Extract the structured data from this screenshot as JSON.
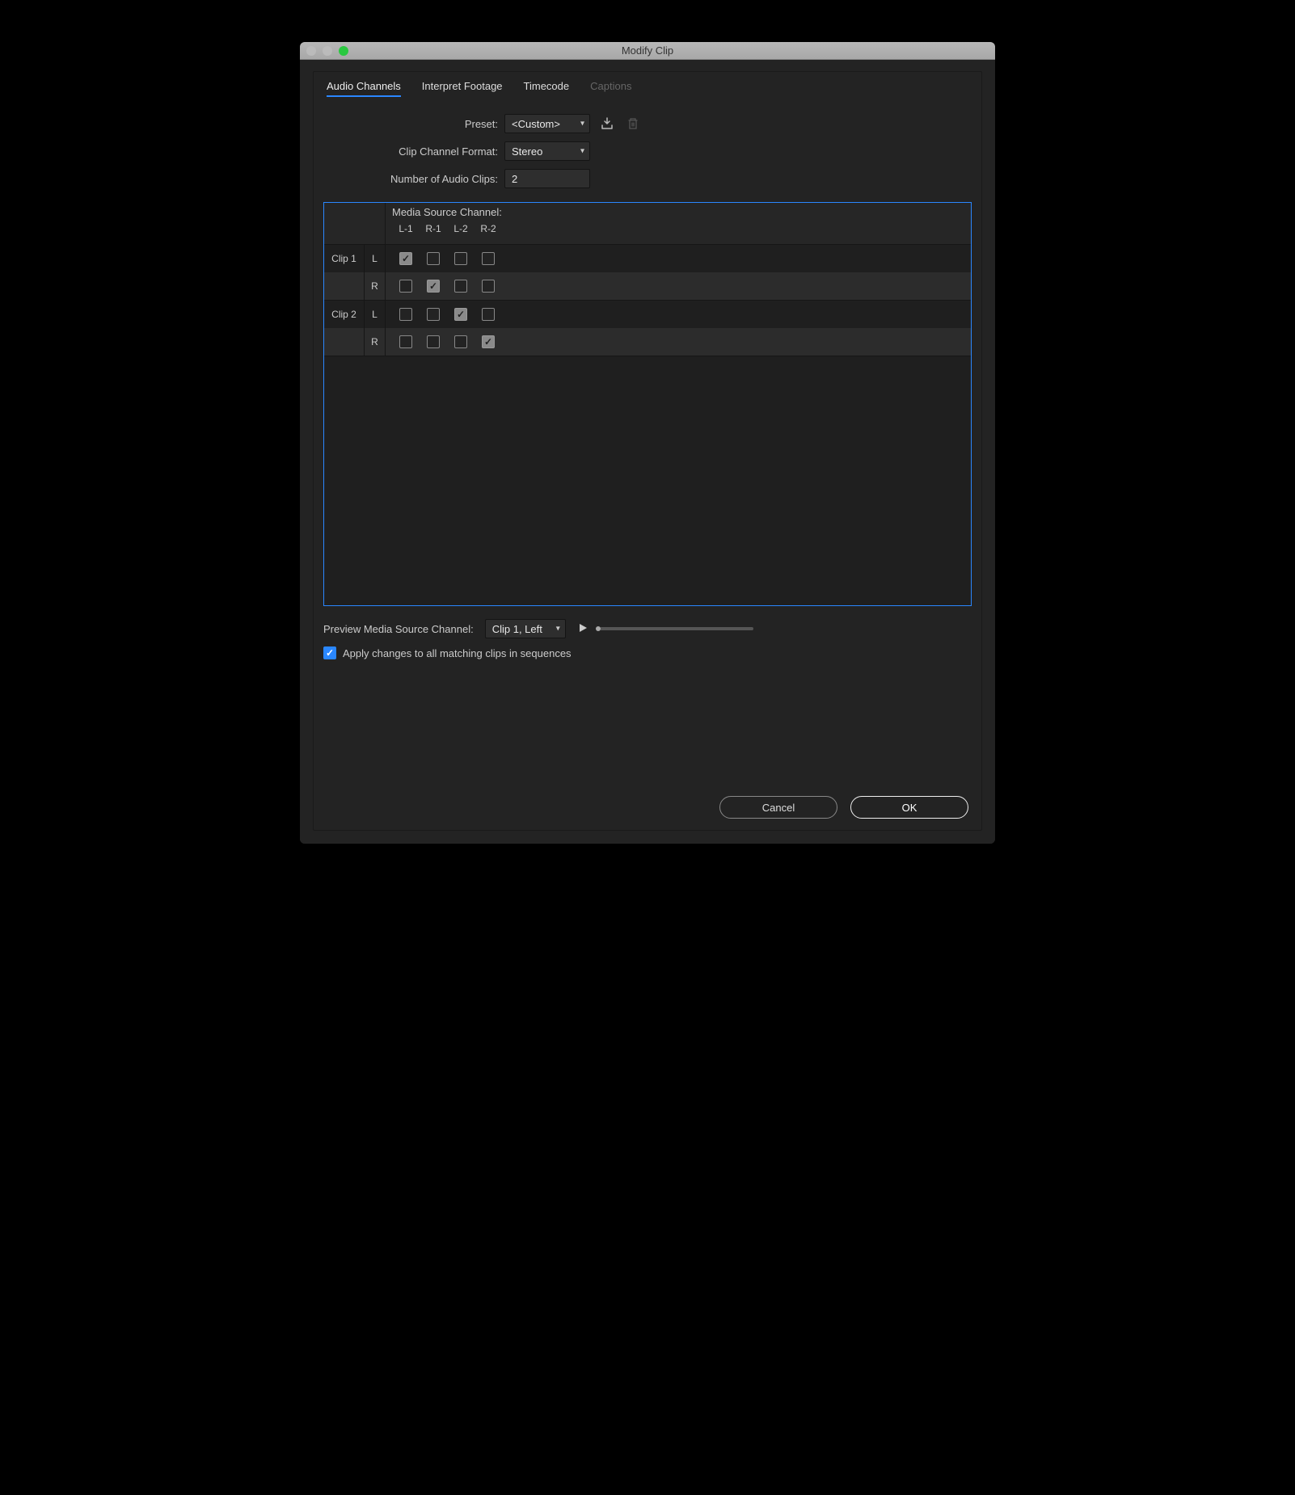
{
  "window": {
    "title": "Modify Clip"
  },
  "tabs": {
    "audio_channels": "Audio Channels",
    "interpret_footage": "Interpret Footage",
    "timecode": "Timecode",
    "captions": "Captions"
  },
  "form": {
    "preset_label": "Preset:",
    "preset_value": "<Custom>",
    "format_label": "Clip Channel Format:",
    "format_value": "Stereo",
    "numclips_label": "Number of Audio Clips:",
    "numclips_value": "2"
  },
  "grid": {
    "header_title": "Media Source Channel:",
    "col_labels": [
      "L-1",
      "R-1",
      "L-2",
      "R-2"
    ],
    "clips": [
      {
        "name": "Clip 1",
        "rows": [
          {
            "side": "L",
            "checks": [
              true,
              false,
              false,
              false
            ]
          },
          {
            "side": "R",
            "checks": [
              false,
              true,
              false,
              false
            ]
          }
        ]
      },
      {
        "name": "Clip 2",
        "rows": [
          {
            "side": "L",
            "checks": [
              false,
              false,
              true,
              false
            ]
          },
          {
            "side": "R",
            "checks": [
              false,
              false,
              false,
              true
            ]
          }
        ]
      }
    ]
  },
  "preview": {
    "label": "Preview Media Source Channel:",
    "value": "Clip 1, Left"
  },
  "apply": {
    "label": "Apply changes to all matching clips in sequences",
    "checked": true
  },
  "buttons": {
    "cancel": "Cancel",
    "ok": "OK"
  },
  "icons": {
    "save_preset": "save-preset-icon",
    "delete_preset": "trash-icon",
    "play": "play-icon"
  }
}
